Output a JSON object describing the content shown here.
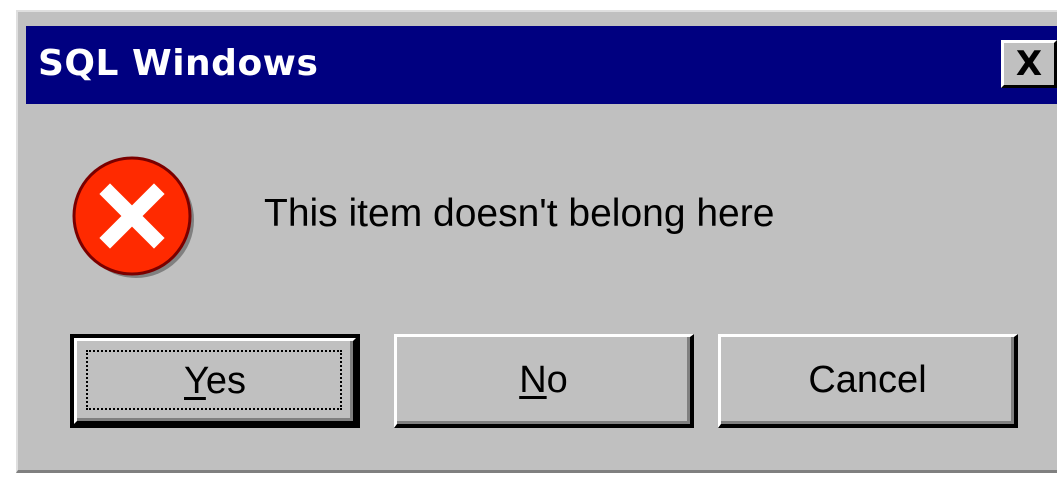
{
  "window": {
    "title": "SQL Windows",
    "close_label": "X"
  },
  "message": {
    "text": "This item doesn't belong here",
    "icon": "error-icon"
  },
  "buttons": {
    "yes": {
      "accel": "Y",
      "rest": "es"
    },
    "no": {
      "accel": "N",
      "rest": "o"
    },
    "cancel": {
      "label": "Cancel"
    }
  },
  "colors": {
    "titlebar": "#000080",
    "face": "#c0c0c0",
    "error_red": "#ff2a00"
  }
}
